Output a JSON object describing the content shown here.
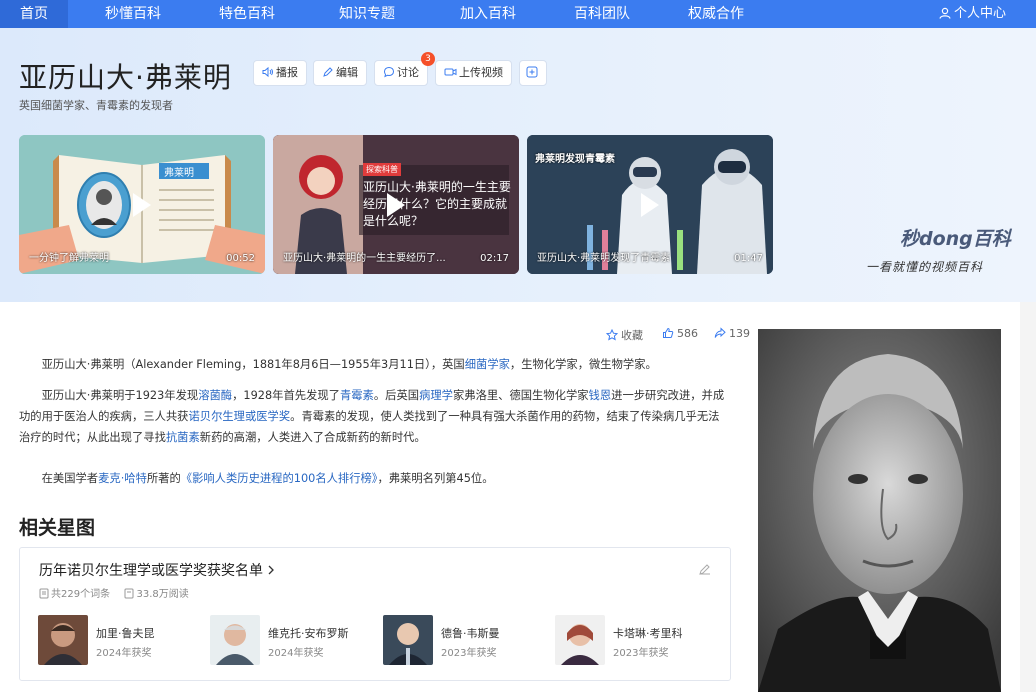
{
  "nav": {
    "items": [
      "首页",
      "秒懂百科",
      "特色百科",
      "知识专题",
      "加入百科",
      "百科团队",
      "权威合作"
    ],
    "user": "个人中心"
  },
  "header": {
    "title": "亚历山大·弗莱明",
    "subtitle": "英国细菌学家、青霉素的发现者",
    "buttons": {
      "report": "播报",
      "edit": "编辑",
      "discuss": "讨论",
      "upload": "上传视频"
    },
    "discuss_badge": "3"
  },
  "videos": [
    {
      "caption": "一分钟了解弗莱明",
      "duration": "00:52",
      "book_label": "弗莱明"
    },
    {
      "caption": "亚历山大·弗莱明的一生主要经历了...",
      "duration": "02:17",
      "overlay": "亚历山大·弗莱明的一生主要经历了什么？它的主要成就是什么呢？",
      "tag": "探索科普"
    },
    {
      "caption": "亚历山大·弗莱明发现了青霉素",
      "duration": "01:47",
      "overlay": "弗莱明发现青霉素"
    }
  ],
  "brand": {
    "logo": "秒dong百科",
    "slogan": "一看就懂的视频百科"
  },
  "stats": {
    "collect": "收藏",
    "likes": "586",
    "shares": "139"
  },
  "paragraphs": {
    "p1": [
      "亚历山大·弗莱明（Alexander Fleming，1881年8月6日—1955年3月11日），英国",
      "细菌学家",
      "，生物化学家，微生物学家。"
    ],
    "p2": [
      "亚历山大·弗莱明于1923年发现",
      "溶菌酶",
      "，1928年首先发现了",
      "青霉素",
      "。后英国",
      "病理学",
      "家弗洛里、德国生物化学家",
      "钱恩",
      "进一步研究改进，并成功的用于医治人的疾病，三人共获",
      "诺贝尔生理或医学奖",
      "。青霉素的发现，使人类找到了一种具有强大杀菌作用的药物，结束了传染病几乎无法治疗的时代；从此出现了寻找",
      "抗菌素",
      "新药的高潮，人类进入了合成新药的新时代。"
    ],
    "p3": [
      "在美国学者",
      "麦克·哈特",
      "所著的",
      "《影响人类历史进程的100名人排行榜》",
      "，弗莱明名列第45位。"
    ]
  },
  "related": {
    "section_title": "相关星图",
    "list_title": "历年诺贝尔生理学或医学奖获奖名单",
    "count": "共229个词条",
    "reads": "33.8万阅读",
    "people": [
      {
        "name": "加里·鲁夫昆",
        "year": "2024年获奖"
      },
      {
        "name": "维克托·安布罗斯",
        "year": "2024年获奖"
      },
      {
        "name": "德鲁·韦斯曼",
        "year": "2023年获奖"
      },
      {
        "name": "卡塔琳·考里科",
        "year": "2023年获奖"
      }
    ]
  }
}
